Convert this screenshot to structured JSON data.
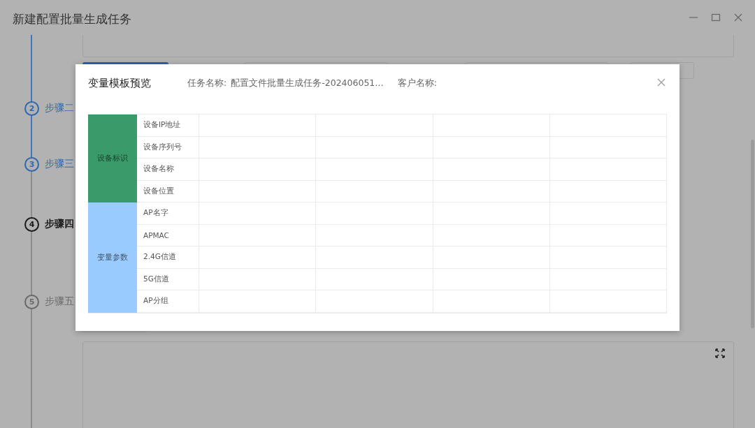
{
  "window": {
    "title": "新建配置批量生成任务"
  },
  "steps": [
    {
      "number": "2",
      "label": "步骤二",
      "completed": true,
      "current": false
    },
    {
      "number": "3",
      "label": "步骤三",
      "completed": true,
      "current": false
    },
    {
      "number": "4",
      "label": "步骤四",
      "completed": false,
      "current": true
    },
    {
      "number": "5",
      "label": "步骤五",
      "completed": false,
      "current": false
    }
  ],
  "modal": {
    "title": "变量模板预览",
    "task_name": {
      "label": "任务名称:",
      "value": "配置文件批量生成任务-202406051…"
    },
    "customer_name": {
      "label": "客户名称:"
    }
  },
  "table": {
    "groups": [
      {
        "label": "设备标识",
        "color": "#3a9a6a",
        "rows": [
          "设备IP地址",
          "设备序列号",
          "设备名称",
          "设备位置"
        ]
      },
      {
        "label": "变量参数",
        "color": "#99cbfe",
        "rows": [
          "AP名字",
          "APMAC",
          "2.4G信道",
          "5G信道",
          "AP分组"
        ]
      }
    ]
  }
}
